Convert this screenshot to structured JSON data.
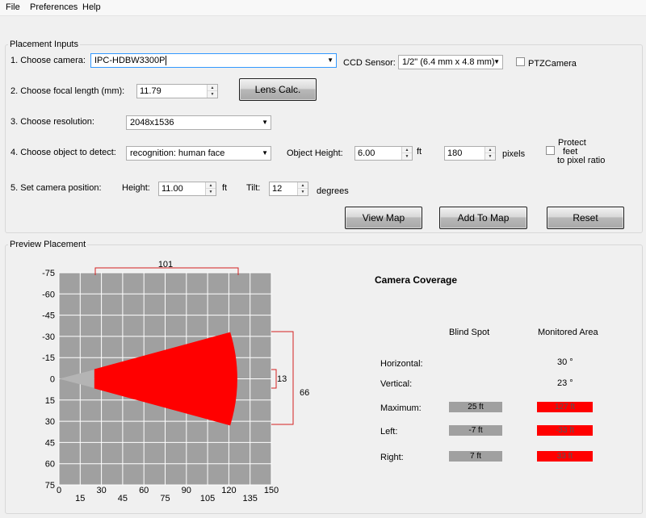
{
  "menu": {
    "items": [
      "File",
      "Preferences",
      "Help"
    ]
  },
  "placement": {
    "title": "Placement Inputs",
    "camera_label": "1. Choose camera:",
    "camera_value": "IPC-HDBW3300P",
    "ccd_label": "CCD Sensor:",
    "ccd_value": "1/2\" (6.4 mm x 4.8 mm)",
    "ptz_label": "PTZCamera",
    "focal_label": "2. Choose focal length (mm):",
    "focal_value": "11.79",
    "lens_button": "Lens Calc.",
    "resolution_label": "3. Choose resolution:",
    "resolution_value": "2048x1536",
    "object_label": "4. Choose object to detect:",
    "object_value": "recognition: human face",
    "object_height_label": "Object Height:",
    "object_height_value": "6.00",
    "object_height_unit": "ft",
    "pixels_value": "180",
    "pixels_unit": "pixels",
    "protect_label_1": "Protect",
    "protect_label_2": "feet",
    "protect_label_3": "to pixel ratio",
    "position_label": "5. Set camera position:",
    "height_label": "Height:",
    "height_value": "11.00",
    "height_unit": "ft",
    "tilt_label": "Tilt:",
    "tilt_value": "12",
    "tilt_unit": "degrees",
    "view_map_button": "View Map",
    "add_map_button": "Add To Map",
    "reset_button": "Reset"
  },
  "preview": {
    "title": "Preview Placement",
    "coverage_title": "Camera Coverage",
    "col_blind": "Blind Spot",
    "col_monitored": "Monitored Area",
    "row_horizontal": "Horizontal:",
    "row_vertical": "Vertical:",
    "row_maximum": "Maximum:",
    "row_left": "Left:",
    "row_right": "Right:",
    "horizontal_value": "30 °",
    "vertical_value": "23 °",
    "max_blind": "25 ft",
    "max_monitored": "127 ft",
    "left_blind": "-7 ft",
    "left_monitored": "-33 ft",
    "right_blind": "7 ft",
    "right_monitored": "33 ft",
    "colors": {
      "coverage": "#ff0000",
      "grid_bg": "#a0a0a0",
      "blind": "#b4b4b4",
      "dimension": "#d42020"
    }
  },
  "plot": {
    "x_ticks_top": [
      "0",
      "30",
      "60",
      "90",
      "120",
      "150"
    ],
    "x_ticks_bottom": [
      "15",
      "45",
      "75",
      "105",
      "135"
    ],
    "y_ticks": [
      "-75",
      "-60",
      "-45",
      "-30",
      "-15",
      "0",
      "15",
      "30",
      "45",
      "60",
      "75"
    ],
    "dim_top": "101",
    "dim_right_inner": "13",
    "dim_right_outer": "66",
    "blind_distance": 25,
    "max_distance": 127,
    "half_width": 33
  }
}
